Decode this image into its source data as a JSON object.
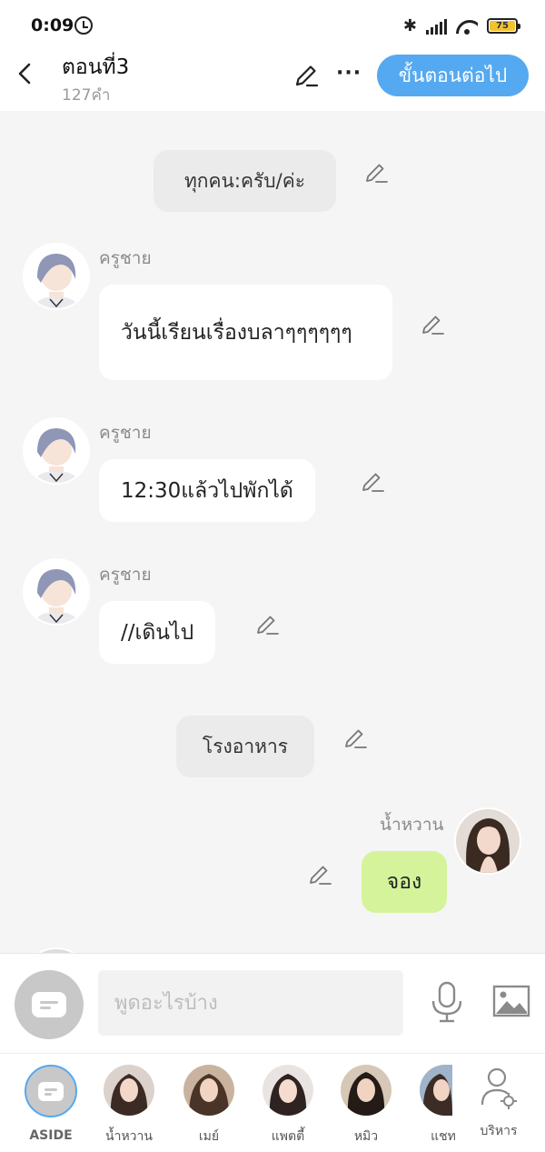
{
  "status_bar": {
    "time": "0:09",
    "battery": "75"
  },
  "header": {
    "title": "ตอนที่3",
    "word_count": "127คำ",
    "next_button": "ขั้นตอนต่อไป"
  },
  "messages": {
    "narration_1": "ทุกคน:ครับ/ค่ะ",
    "m1_name": "ครูชาย",
    "m1_text": "วันนี้เรียนเรื่องบลาๆๆๆๆๆๆ",
    "m2_name": "ครูชาย",
    "m2_text": "12:30แล้วไปพักได้",
    "m3_name": "ครูชาย",
    "m3_text": "//เดินไป",
    "narration_2": "โรงอาหาร",
    "m4_name": "น้ำหวาน",
    "m4_text": "จอง"
  },
  "input": {
    "placeholder": "พูดอะไรบ้าง"
  },
  "characters": [
    {
      "label": "ASIDE"
    },
    {
      "label": "น้ำหวาน"
    },
    {
      "label": "เมย์"
    },
    {
      "label": "แพตตี้"
    },
    {
      "label": "หมิว"
    },
    {
      "label": "แชท"
    },
    {
      "label": "บริหาร"
    }
  ],
  "colors": {
    "accent": "#55a9f0",
    "own_bubble": "#d4f39a",
    "narration_bg": "#ebebeb",
    "chat_bg": "#f5f5f5"
  }
}
